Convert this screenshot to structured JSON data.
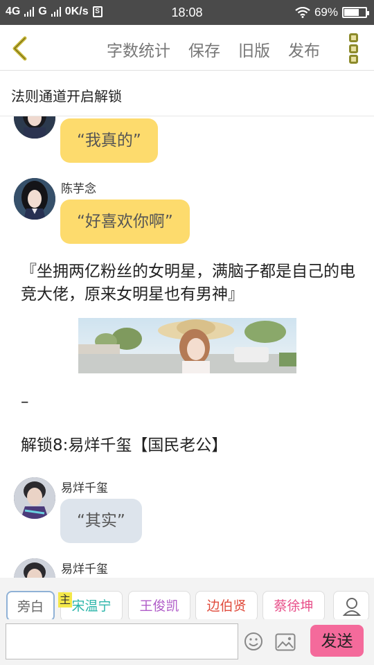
{
  "status_bar": {
    "network_1": "4G",
    "network_2": "G",
    "speed": "0K/s",
    "sim_icon": "S",
    "time": "18:08",
    "battery": "69%",
    "battery_level": 0.69
  },
  "nav": {
    "back_icon": "chevron-left-icon",
    "links": [
      "字数统计",
      "保存",
      "旧版",
      "发布"
    ],
    "more_icon": "more-vertical-icon"
  },
  "title": "法则通道开启解锁",
  "messages": {
    "m1": {
      "text": "“我真的”"
    },
    "m2": {
      "name": "陈芋念",
      "text": "“好喜欢你啊”"
    },
    "para1": "『坐拥两亿粉丝的女明星，满脑子都是自己的电竞大佬，原来女明星也有男神』",
    "dash": "–",
    "para2": "解锁8:易烊千玺【国民老公】",
    "m3": {
      "name": "易烊千玺",
      "text": "“其实”"
    },
    "m4": {
      "name": "易烊千玺"
    }
  },
  "roles": {
    "narrator": "旁白",
    "main_tag": "主",
    "chips": [
      {
        "label": "宋温宁",
        "color": "#2bb5a9"
      },
      {
        "label": "王俊凯",
        "color": "#b05cc8"
      },
      {
        "label": "边伯贤",
        "color": "#e04b3c"
      },
      {
        "label": "蔡徐坤",
        "color": "#e8508a"
      }
    ]
  },
  "input": {
    "value": "",
    "send_label": "发送"
  },
  "colors": {
    "accent_yellow": "#fddb6d",
    "send_pink": "#f46a9b",
    "bubble_gray": "#dde4ec"
  }
}
